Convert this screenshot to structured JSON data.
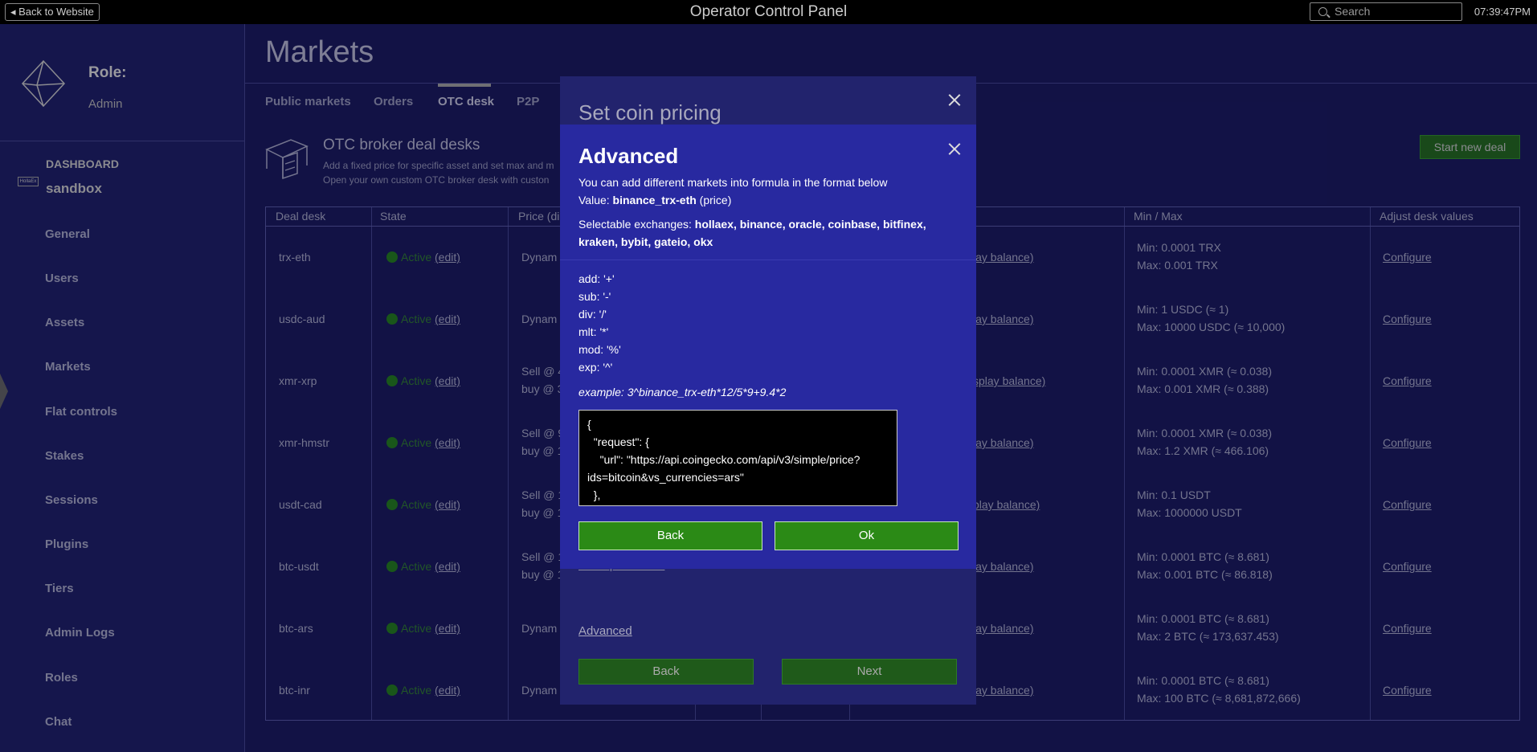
{
  "topbar": {
    "back_label": "Back to Website",
    "title": "Operator Control Panel",
    "search_placeholder": "Search",
    "clock": "07:39:47PM"
  },
  "sidebar": {
    "role_label": "Role:",
    "role_value": "Admin",
    "dashboard_label": "DASHBOARD",
    "exchange_logo_text": "HollaEx",
    "exchange_name": "sandbox",
    "items": [
      {
        "label": "General"
      },
      {
        "label": "Users"
      },
      {
        "label": "Assets"
      },
      {
        "label": "Markets"
      },
      {
        "label": "Flat controls"
      },
      {
        "label": "Stakes"
      },
      {
        "label": "Sessions"
      },
      {
        "label": "Plugins"
      },
      {
        "label": "Tiers"
      },
      {
        "label": "Admin Logs"
      },
      {
        "label": "Roles"
      },
      {
        "label": "Chat"
      }
    ],
    "active_item": "Markets"
  },
  "main": {
    "title": "Markets",
    "tabs": [
      {
        "label": "Public markets"
      },
      {
        "label": "Orders"
      },
      {
        "label": "OTC desk"
      },
      {
        "label": "P2P"
      }
    ],
    "active_tab": "OTC desk",
    "desk_heading": "OTC broker deal desks",
    "desk_desc_1": "Add a fixed price for specific asset and set max and m",
    "desk_desc_2": "Open your own custom OTC broker desk with custon",
    "new_deal_label": "Start new deal"
  },
  "table": {
    "headers": {
      "deal_desk": "Deal desk",
      "state": "State",
      "price": "Price (di",
      "min_max": "Min / Max",
      "adjust": "Adjust desk values"
    },
    "active_label": "Active",
    "edit_label": "(edit)",
    "configure_label": "Configure",
    "rows": [
      {
        "desk": "trx-eth",
        "price_1": "Dynam",
        "price_2": "",
        "balance": "lay balance)",
        "min": "Min: 0.0001 TRX",
        "max": "Max: 0.001 TRX"
      },
      {
        "desk": "usdc-aud",
        "price_1": "Dynam",
        "price_2": "",
        "balance": "lay balance)",
        "min": "Min: 1 USDC (≈ 1)",
        "max": "Max: 10000 USDC (≈ 10,000)"
      },
      {
        "desk": "xmr-xrp",
        "price_1": "Sell @ 4",
        "price_2": "buy @ 3",
        "balance": "splay balance)",
        "min": "Min: 0.0001 XMR (≈ 0.038)",
        "max": "Max: 0.001 XMR (≈ 0.388)"
      },
      {
        "desk": "xmr-hmstr",
        "price_1": "Sell @ 9",
        "price_2": "buy @ 1",
        "balance": "lay balance)",
        "min": "Min: 0.0001 XMR (≈ 0.038)",
        "max": "Max: 1.2 XMR (≈ 466.106)"
      },
      {
        "desk": "usdt-cad",
        "price_1": "Sell @ 1",
        "price_2": "buy @ 1",
        "balance": "play balance)",
        "min": "Min: 0.1 USDT",
        "max": "Max: 1000000 USDT"
      },
      {
        "desk": "btc-usdt",
        "price_1": "Sell @ 1",
        "price_2": "buy @ 1",
        "balance": "lay balance)",
        "min": "Min: 0.0001 BTC (≈ 8.681)",
        "max": "Max: 0.001 BTC (≈ 86.818)"
      },
      {
        "desk": "btc-ars",
        "price_1": "Dynam",
        "price_2": "",
        "balance": "lay balance)",
        "min": "Min: 0.0001 BTC (≈ 8.681)",
        "max": "Max: 2 BTC (≈ 173,637.453)"
      },
      {
        "desk": "btc-inr",
        "price_1": "Dynam",
        "price_2": "",
        "balance": "lay balance)",
        "min": "Min: 0.0001 BTC (≈ 8.681)",
        "max": "Max: 100 BTC (≈ 8,681,872,666)"
      }
    ]
  },
  "outer_modal": {
    "title": "Set coin pricing",
    "partial_link": "Show price result",
    "advanced_link": "Advanced",
    "back_label": "Back",
    "next_label": "Next"
  },
  "inner_modal": {
    "title": "Advanced",
    "intro": "You can add different markets into formula in the format below",
    "value_prefix": "Value: ",
    "value_bold": "binance_trx-eth",
    "value_suffix": " (price)",
    "exchanges_prefix": "Selectable exchanges: ",
    "exchanges_line1": "hollaex, binance, oracle, coinbase, bitfinex,",
    "exchanges_line2": "kraken, bybit, gateio, okx",
    "ops": [
      "add: '+'",
      "sub: '-'",
      "div: '/'",
      "mlt: '*'",
      "mod: '%'",
      "exp: '^'"
    ],
    "example": "example: 3^binance_trx-eth*12/5*9+9.4*2",
    "code": "{\n  \"request\": {\n    \"url\": \"https://api.coingecko.com/api/v3/simple/price?ids=bitcoin&vs_currencies=ars\"\n  },",
    "back_label": "Back",
    "ok_label": "Ok"
  },
  "colors": {
    "background": "#16164f",
    "sidebar": "#1a1b57",
    "inner_modal": "#2829a0",
    "outer_modal": "#22236d",
    "primary_button": "#2b8a16",
    "active_green": "#1f6a1a"
  }
}
